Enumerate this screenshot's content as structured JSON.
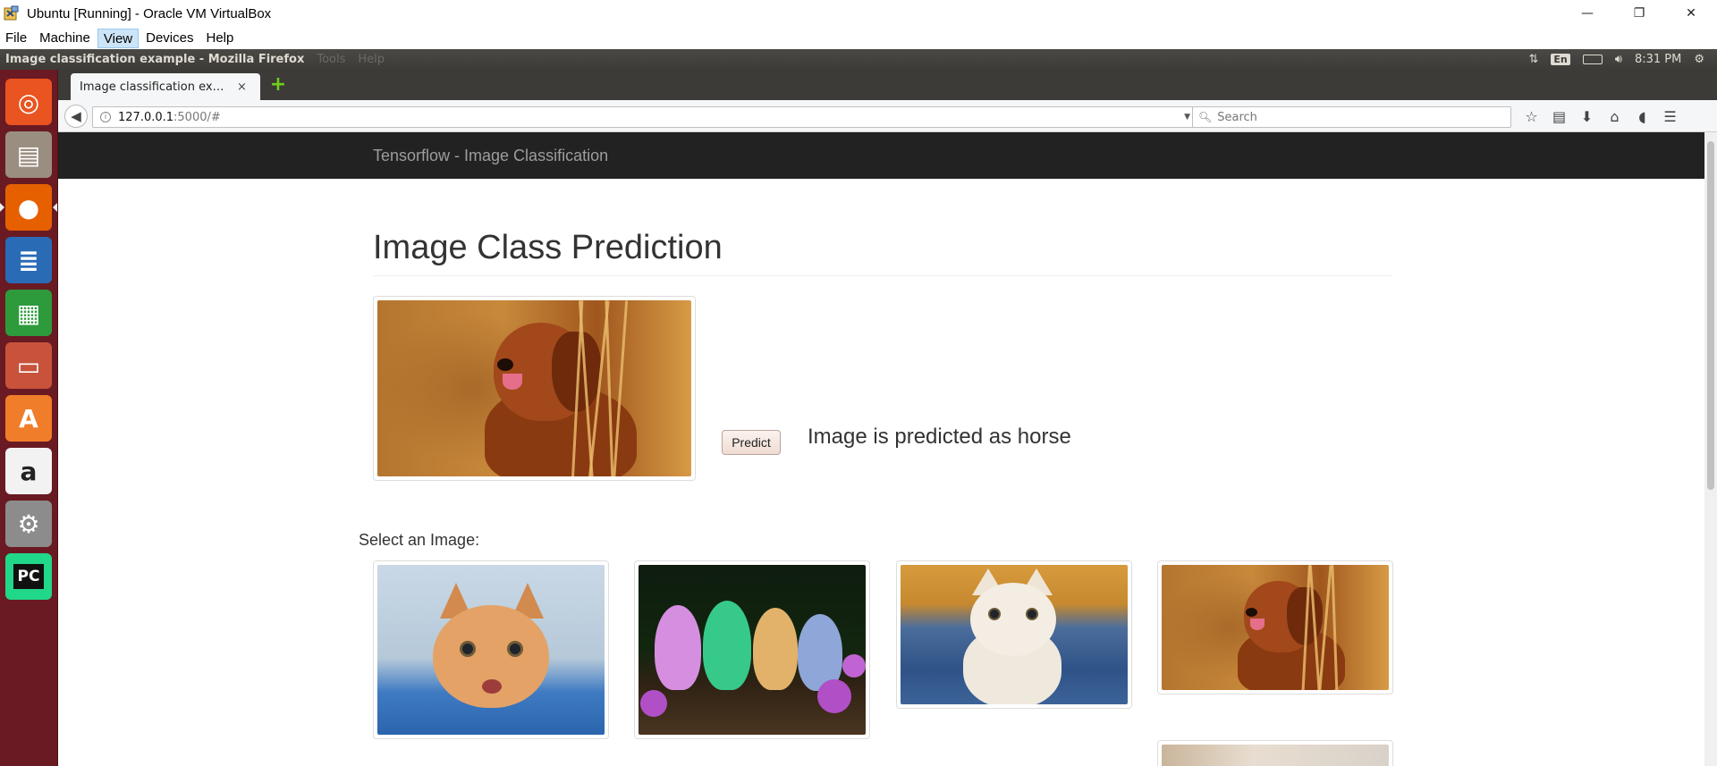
{
  "host_window": {
    "title": "Ubuntu [Running] - Oracle VM VirtualBox",
    "menu": [
      "File",
      "Machine",
      "View",
      "Devices",
      "Help"
    ],
    "active_menu": "View",
    "controls": {
      "minimize": "—",
      "restore": "❐",
      "close": "✕"
    }
  },
  "ubuntu_panel": {
    "app_title": "Image classification example - Mozilla Firefox",
    "ghost_menus": [
      "Tools",
      "Help"
    ],
    "keyboard": "En",
    "clock": "8:31 PM"
  },
  "launcher": {
    "items": [
      {
        "name": "ubuntu-dash-icon",
        "bg": "#e95420",
        "glyph": "◎"
      },
      {
        "name": "files-icon",
        "bg": "#9a8e80",
        "glyph": "▤"
      },
      {
        "name": "firefox-icon",
        "bg": "#e66000",
        "glyph": "●"
      },
      {
        "name": "libreoffice-writer-icon",
        "bg": "#2a6bb5",
        "glyph": "≣"
      },
      {
        "name": "libreoffice-calc-icon",
        "bg": "#2d9a3c",
        "glyph": "▦"
      },
      {
        "name": "libreoffice-impress-icon",
        "bg": "#c8533a",
        "glyph": "▭"
      },
      {
        "name": "software-center-icon",
        "bg": "#f07d2a",
        "glyph": "A"
      },
      {
        "name": "amazon-icon",
        "bg": "#f2f2f2",
        "glyph": "a"
      },
      {
        "name": "system-settings-icon",
        "bg": "#8c8c8c",
        "glyph": "⚙"
      },
      {
        "name": "pycharm-icon",
        "bg": "#21d789",
        "glyph": "PC"
      }
    ]
  },
  "browser": {
    "tab_title": "Image classification ex…",
    "tab_close": "×",
    "new_tab": "+",
    "url_host": "127.0.0.1",
    "url_rest": ":5000/#",
    "search_placeholder": "Search"
  },
  "page": {
    "brand": "Tensorflow - Image Classification",
    "heading": "Image Class Prediction",
    "predict_button": "Predict",
    "prediction_text": "Image is predicted as horse",
    "select_label": "Select an Image:"
  }
}
